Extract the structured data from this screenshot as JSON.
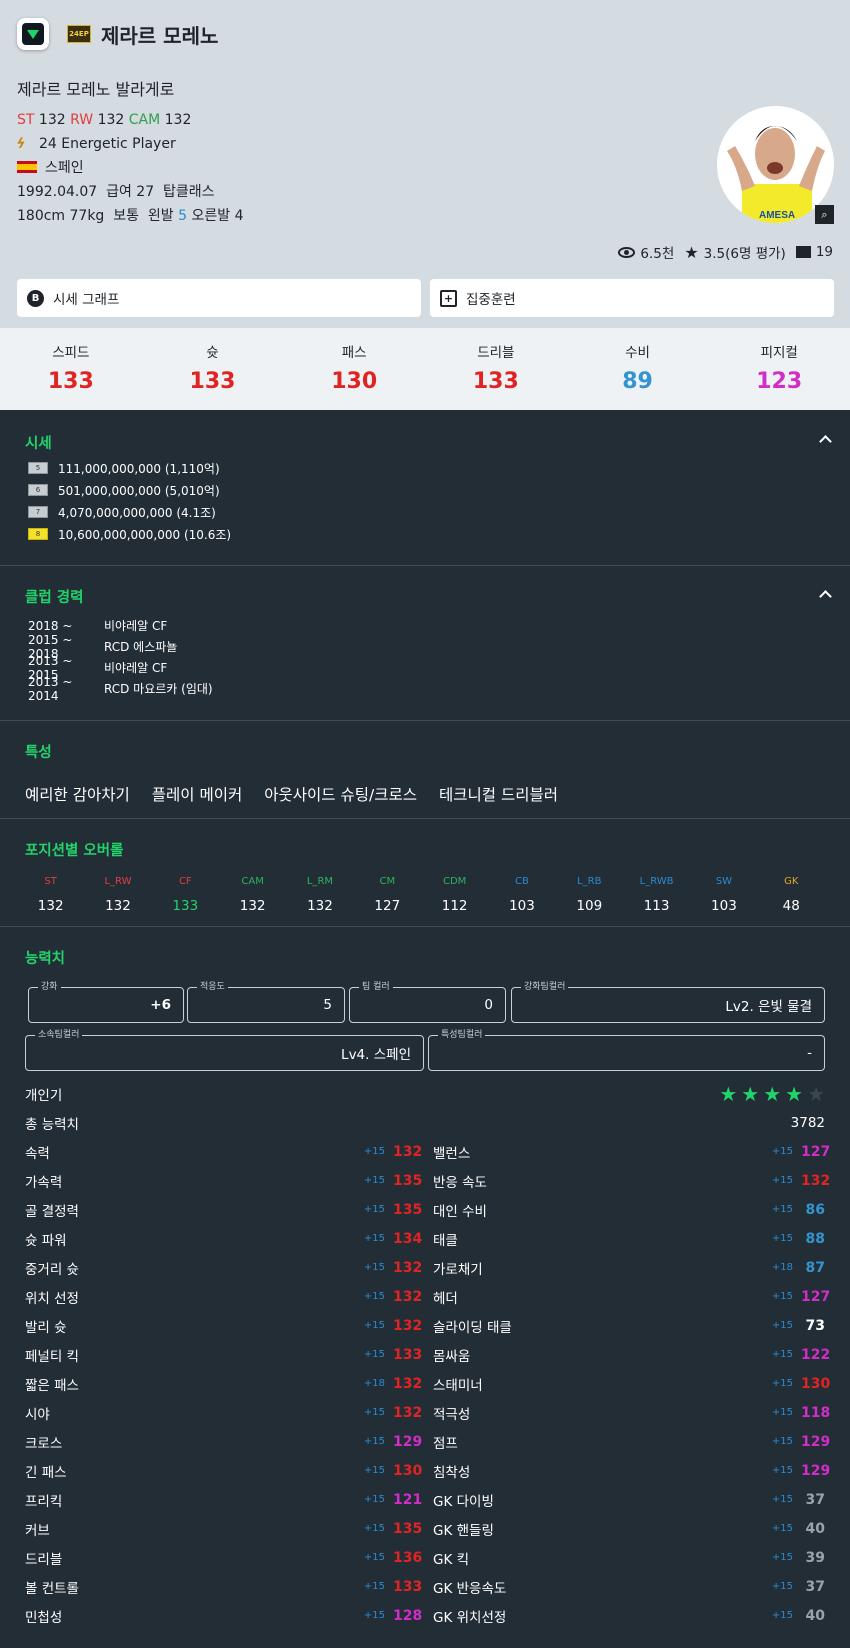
{
  "header": {
    "season_badge": "24EP",
    "name": "제라르 모레노"
  },
  "player": {
    "full_name": "제라르 모레노 발라게로",
    "positions": [
      {
        "pos": "ST",
        "val": "132"
      },
      {
        "pos": "RW",
        "val": "132"
      },
      {
        "pos": "CAM",
        "val": "132"
      }
    ],
    "season_name": "24 Energetic Player",
    "nation": "스페인",
    "birth": "1992.04.07",
    "salary": "급여 27",
    "club_class": "탑클래스",
    "body": "180cm 77kg",
    "body_type": "보통",
    "left_foot_label": "왼발",
    "left_foot": "5",
    "right_foot_label": "오른발",
    "right_foot": "4"
  },
  "meta": {
    "views": "6.5천",
    "rating": "3.5(6명 평가)",
    "comments": "19"
  },
  "buttons": {
    "price_graph": "시세 그래프",
    "training": "집중훈련"
  },
  "stats": [
    {
      "label": "스피드",
      "value": "133",
      "color": "#e02424"
    },
    {
      "label": "슛",
      "value": "133",
      "color": "#e02424"
    },
    {
      "label": "패스",
      "value": "130",
      "color": "#e02424"
    },
    {
      "label": "드리블",
      "value": "133",
      "color": "#e02424"
    },
    {
      "label": "수비",
      "value": "89",
      "color": "#3494cf"
    },
    {
      "label": "피지컬",
      "value": "123",
      "color": "#d12dc9"
    }
  ],
  "price": {
    "title": "시세",
    "rows": [
      {
        "grade": "5",
        "value": "111,000,000,000 (1,110억)"
      },
      {
        "grade": "6",
        "value": "501,000,000,000 (5,010억)"
      },
      {
        "grade": "7",
        "value": "4,070,000,000,000 (4.1조)"
      },
      {
        "grade": "8",
        "value": "10,600,000,000,000 (10.6조)"
      }
    ]
  },
  "club": {
    "title": "클럽 경력",
    "rows": [
      {
        "years": "2018 ~",
        "club": "비야레알 CF"
      },
      {
        "years": "2015 ~ 2018",
        "club": "RCD 에스파뇰"
      },
      {
        "years": "2013 ~ 2015",
        "club": "비야레알 CF"
      },
      {
        "years": "2013 ~ 2014",
        "club": "RCD 마요르카 (임대)"
      }
    ]
  },
  "traits": {
    "title": "특성",
    "items": [
      "예리한 감아차기",
      "플레이 메이커",
      "아웃사이드 슈팅/크로스",
      "테크니컬 드리블러"
    ]
  },
  "overall": {
    "title": "포지션별 오버롤",
    "items": [
      {
        "pos": "ST",
        "val": "132",
        "pc": "#e33e3e",
        "vc": "#ffffff"
      },
      {
        "pos": "L_RW",
        "val": "132",
        "pc": "#e33e3e",
        "vc": "#ffffff"
      },
      {
        "pos": "CF",
        "val": "133",
        "pc": "#e33e3e",
        "vc": "#22d36b"
      },
      {
        "pos": "CAM",
        "val": "132",
        "pc": "#2fb35c",
        "vc": "#ffffff"
      },
      {
        "pos": "L_RM",
        "val": "132",
        "pc": "#2fb35c",
        "vc": "#ffffff"
      },
      {
        "pos": "CM",
        "val": "127",
        "pc": "#2fb35c",
        "vc": "#ffffff"
      },
      {
        "pos": "CDM",
        "val": "112",
        "pc": "#2fb35c",
        "vc": "#ffffff"
      },
      {
        "pos": "CB",
        "val": "103",
        "pc": "#2a8bd0",
        "vc": "#ffffff"
      },
      {
        "pos": "L_RB",
        "val": "109",
        "pc": "#2a8bd0",
        "vc": "#ffffff"
      },
      {
        "pos": "L_RWB",
        "val": "113",
        "pc": "#2a8bd0",
        "vc": "#ffffff"
      },
      {
        "pos": "SW",
        "val": "103",
        "pc": "#2a8bd0",
        "vc": "#ffffff"
      },
      {
        "pos": "GK",
        "val": "48",
        "pc": "#e0a526",
        "vc": "#ffffff"
      }
    ]
  },
  "ability": {
    "title": "능력치",
    "fields": [
      {
        "label": "강화",
        "value": "+6"
      },
      {
        "label": "적응도",
        "value": "5"
      },
      {
        "label": "팀 컬러",
        "value": "0"
      },
      {
        "label": "강화팀컬러",
        "value": "Lv2. 은빛 물결"
      },
      {
        "label": "소속팀컬러",
        "value": "Lv4. 스페인"
      },
      {
        "label": "특성팀컬러",
        "value": "-"
      }
    ],
    "popularity_label": "개인기",
    "popularity_stars": 4,
    "total_label": "총 능력치",
    "total": "3782"
  },
  "attributes_left": [
    {
      "n": "속력",
      "p": "+15",
      "v": "132",
      "c": "#e02424"
    },
    {
      "n": "가속력",
      "p": "+15",
      "v": "135",
      "c": "#e02424"
    },
    {
      "n": "골 결정력",
      "p": "+15",
      "v": "135",
      "c": "#e02424"
    },
    {
      "n": "슛 파워",
      "p": "+15",
      "v": "134",
      "c": "#e02424"
    },
    {
      "n": "중거리 슛",
      "p": "+15",
      "v": "132",
      "c": "#e02424"
    },
    {
      "n": "위치 선정",
      "p": "+15",
      "v": "132",
      "c": "#e02424"
    },
    {
      "n": "발리 슛",
      "p": "+15",
      "v": "132",
      "c": "#e02424"
    },
    {
      "n": "페널티 킥",
      "p": "+15",
      "v": "133",
      "c": "#e02424"
    },
    {
      "n": "짧은 패스",
      "p": "+18",
      "v": "132",
      "c": "#e02424"
    },
    {
      "n": "시야",
      "p": "+15",
      "v": "132",
      "c": "#e02424"
    },
    {
      "n": "크로스",
      "p": "+15",
      "v": "129",
      "c": "#d12dc9"
    },
    {
      "n": "긴 패스",
      "p": "+15",
      "v": "130",
      "c": "#e02424"
    },
    {
      "n": "프리킥",
      "p": "+15",
      "v": "121",
      "c": "#d12dc9"
    },
    {
      "n": "커브",
      "p": "+15",
      "v": "135",
      "c": "#e02424"
    },
    {
      "n": "드리블",
      "p": "+15",
      "v": "136",
      "c": "#e02424"
    },
    {
      "n": "볼 컨트롤",
      "p": "+15",
      "v": "133",
      "c": "#e02424"
    },
    {
      "n": "민첩성",
      "p": "+15",
      "v": "128",
      "c": "#d12dc9"
    }
  ],
  "attributes_right": [
    {
      "n": "밸런스",
      "p": "+15",
      "v": "127",
      "c": "#d12dc9"
    },
    {
      "n": "반응 속도",
      "p": "+15",
      "v": "132",
      "c": "#e02424"
    },
    {
      "n": "대인 수비",
      "p": "+15",
      "v": "86",
      "c": "#3494cf"
    },
    {
      "n": "태클",
      "p": "+15",
      "v": "88",
      "c": "#3494cf"
    },
    {
      "n": "가로채기",
      "p": "+18",
      "v": "87",
      "c": "#3494cf"
    },
    {
      "n": "헤더",
      "p": "+15",
      "v": "127",
      "c": "#d12dc9"
    },
    {
      "n": "슬라이딩 태클",
      "p": "+15",
      "v": "73",
      "c": "#ffffff"
    },
    {
      "n": "몸싸움",
      "p": "+15",
      "v": "122",
      "c": "#d12dc9"
    },
    {
      "n": "스태미너",
      "p": "+15",
      "v": "130",
      "c": "#e02424"
    },
    {
      "n": "적극성",
      "p": "+15",
      "v": "118",
      "c": "#d12dc9"
    },
    {
      "n": "점프",
      "p": "+15",
      "v": "129",
      "c": "#d12dc9"
    },
    {
      "n": "침착성",
      "p": "+15",
      "v": "129",
      "c": "#d12dc9"
    },
    {
      "n": "GK 다이빙",
      "p": "+15",
      "v": "37",
      "c": "#9aa3aa"
    },
    {
      "n": "GK 핸들링",
      "p": "+15",
      "v": "40",
      "c": "#9aa3aa"
    },
    {
      "n": "GK 킥",
      "p": "+15",
      "v": "39",
      "c": "#9aa3aa"
    },
    {
      "n": "GK 반응속도",
      "p": "+15",
      "v": "37",
      "c": "#9aa3aa"
    },
    {
      "n": "GK 위치선정",
      "p": "+15",
      "v": "40",
      "c": "#9aa3aa"
    }
  ]
}
